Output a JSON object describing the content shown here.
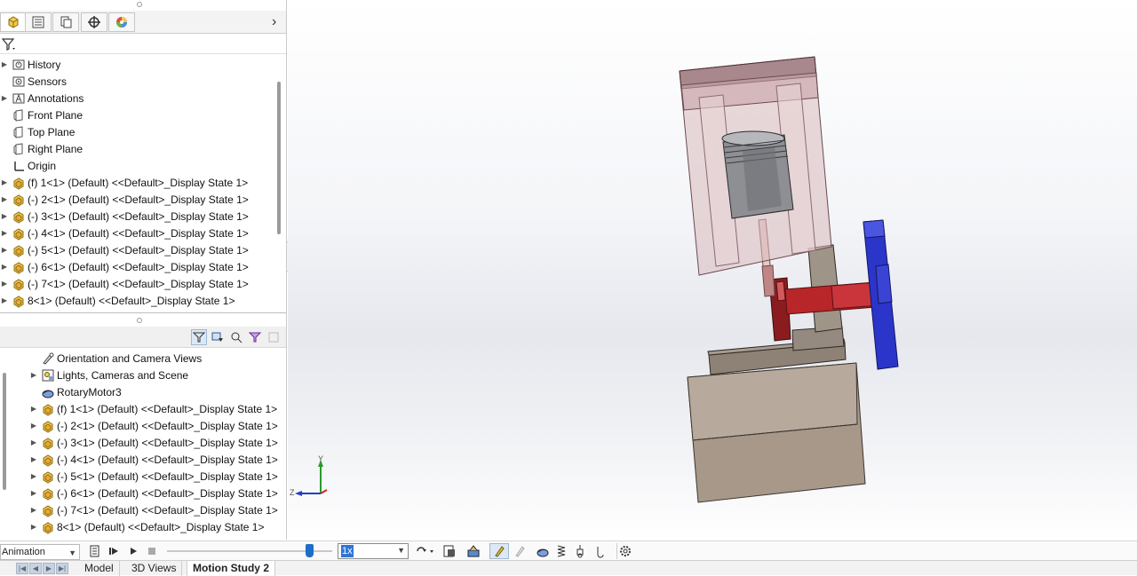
{
  "feature_manager": {
    "tabs": [
      "featuremanager-tab",
      "propertymanager-tab",
      "configurationmanager-tab",
      "dimxpert-tab",
      "display-manager-tab"
    ],
    "tree": [
      {
        "label": "History",
        "icon": "history-icon",
        "expandable": true
      },
      {
        "label": "Sensors",
        "icon": "sensor-icon",
        "expandable": false
      },
      {
        "label": "Annotations",
        "icon": "annotation-icon",
        "expandable": true
      },
      {
        "label": "Front Plane",
        "icon": "plane-icon",
        "expandable": false
      },
      {
        "label": "Top Plane",
        "icon": "plane-icon",
        "expandable": false
      },
      {
        "label": "Right Plane",
        "icon": "plane-icon",
        "expandable": false
      },
      {
        "label": "Origin",
        "icon": "origin-icon",
        "expandable": false
      },
      {
        "label": "(f) 1<1> (Default) <<Default>_Display State 1>",
        "icon": "part-icon",
        "expandable": true
      },
      {
        "label": "(-) 2<1> (Default) <<Default>_Display State 1>",
        "icon": "part-icon",
        "expandable": true
      },
      {
        "label": "(-) 3<1> (Default) <<Default>_Display State 1>",
        "icon": "part-icon",
        "expandable": true
      },
      {
        "label": "(-) 4<1> (Default) <<Default>_Display State 1>",
        "icon": "part-icon",
        "expandable": true
      },
      {
        "label": "(-) 5<1> (Default) <<Default>_Display State 1>",
        "icon": "part-icon",
        "expandable": true
      },
      {
        "label": "(-) 6<1> (Default) <<Default>_Display State 1>",
        "icon": "part-icon",
        "expandable": true
      },
      {
        "label": "(-) 7<1> (Default) <<Default>_Display State 1>",
        "icon": "part-icon",
        "expandable": true
      },
      {
        "label": "8<1> (Default) <<Default>_Display State 1>",
        "icon": "part-icon",
        "expandable": true
      }
    ]
  },
  "motion_manager": {
    "toolbar_icons": [
      "filter-animated-icon",
      "filter-driving-icon",
      "filter-selected-icon",
      "filter-results-icon",
      "filter-disabled-icon"
    ],
    "tree": [
      {
        "label": "Orientation and Camera Views",
        "icon": "camera-view-icon",
        "expandable": false
      },
      {
        "label": "Lights, Cameras and Scene",
        "icon": "lights-icon",
        "expandable": true
      },
      {
        "label": "RotaryMotor3",
        "icon": "rotary-motor-icon",
        "expandable": false
      },
      {
        "label": "(f) 1<1> (Default) <<Default>_Display State 1>",
        "icon": "part-icon",
        "expandable": true
      },
      {
        "label": "(-) 2<1> (Default) <<Default>_Display State 1>",
        "icon": "part-icon",
        "expandable": true
      },
      {
        "label": "(-) 3<1> (Default) <<Default>_Display State 1>",
        "icon": "part-icon",
        "expandable": true
      },
      {
        "label": "(-) 4<1> (Default) <<Default>_Display State 1>",
        "icon": "part-icon",
        "expandable": true
      },
      {
        "label": "(-) 5<1> (Default) <<Default>_Display State 1>",
        "icon": "part-icon",
        "expandable": true
      },
      {
        "label": "(-) 6<1> (Default) <<Default>_Display State 1>",
        "icon": "part-icon",
        "expandable": true
      },
      {
        "label": "(-) 7<1> (Default) <<Default>_Display State 1>",
        "icon": "part-icon",
        "expandable": true
      },
      {
        "label": "8<1> (Default) <<Default>_Display State 1>",
        "icon": "part-icon",
        "expandable": true
      }
    ]
  },
  "triad": {
    "y_label": "Y",
    "z_label": "Z"
  },
  "timeline_toolbar": {
    "study_type": "Animation",
    "speed": "1x",
    "slider_fraction": 0.86
  },
  "bottom_tabs": {
    "model": "Model",
    "views_3d": "3D Views",
    "motion_study": "Motion Study 2",
    "active": "Motion Study 2"
  },
  "colors": {
    "piston_housing": "#d9b9bc",
    "crank_red": "#b8262a",
    "flywheel_blue": "#2b35c9",
    "base_taupe": "#a8988a",
    "accent_blue": "#1e6ec8"
  }
}
